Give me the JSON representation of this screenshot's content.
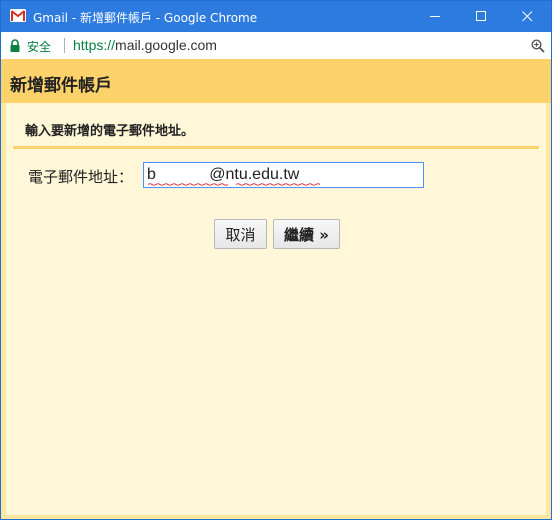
{
  "window": {
    "title": "Gmail - 新增郵件帳戶 - Google Chrome",
    "accent_color": "#2e7be0"
  },
  "address_bar": {
    "security_label": "安全",
    "url_scheme": "https://",
    "url_rest": "mail.google.com"
  },
  "page": {
    "header_title": "新增郵件帳戶",
    "instruction": "輸入要新增的電子郵件地址。",
    "email_label": "電子郵件地址：",
    "email_value": "b            @ntu.edu.tw",
    "cancel_label": "取消",
    "continue_label": "繼續 »"
  },
  "colors": {
    "header_bg": "#fdd26b",
    "panel_bg": "#fff7d8",
    "secure_green": "#0b8043"
  },
  "icons": [
    "gmail-icon",
    "minimize-icon",
    "maximize-icon",
    "close-icon",
    "lock-icon",
    "zoom-icon"
  ]
}
